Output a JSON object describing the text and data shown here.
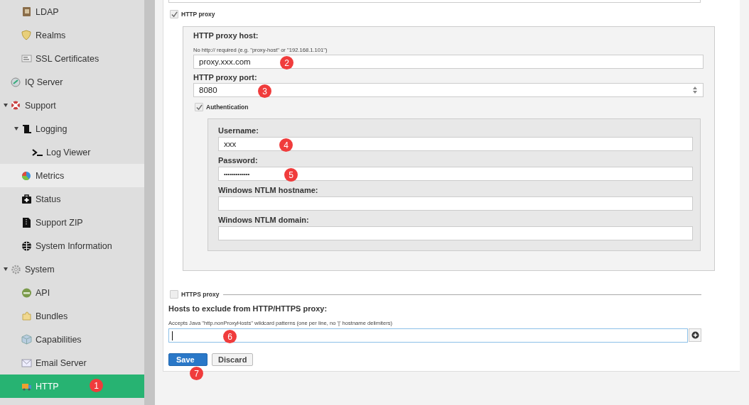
{
  "sidebar": {
    "items": [
      {
        "children": [
          {
            "label": "LDAP",
            "selected": false,
            "hovered": false
          },
          {
            "label": "Realms",
            "selected": false,
            "hovered": false
          },
          {
            "label": "SSL Certificates",
            "selected": false,
            "hovered": false
          }
        ]
      },
      {
        "label": "IQ Server",
        "selected": false,
        "hovered": false
      },
      {
        "label": "Support",
        "selected": false,
        "hovered": false,
        "expanded": true,
        "children": [
          {
            "label": "Logging",
            "selected": false,
            "hovered": false,
            "expanded": true,
            "children": [
              {
                "label": "Log Viewer",
                "selected": false,
                "hovered": false
              }
            ]
          },
          {
            "label": "Metrics",
            "selected": false,
            "hovered": true
          },
          {
            "label": "Status",
            "selected": false,
            "hovered": false
          },
          {
            "label": "Support ZIP",
            "selected": false,
            "hovered": false
          },
          {
            "label": "System Information",
            "selected": false,
            "hovered": false
          }
        ]
      },
      {
        "label": "System",
        "selected": false,
        "hovered": false,
        "expanded": true,
        "children": [
          {
            "label": "API",
            "selected": false,
            "hovered": false
          },
          {
            "label": "Bundles",
            "selected": false,
            "hovered": false
          },
          {
            "label": "Capabilities",
            "selected": false,
            "hovered": false
          },
          {
            "label": "Email Server",
            "selected": false,
            "hovered": false
          },
          {
            "label": "HTTP",
            "selected": true,
            "hovered": false,
            "badge": "1"
          }
        ]
      }
    ]
  },
  "form": {
    "http_proxy": {
      "label": "HTTP proxy",
      "checked": true,
      "host_label": "HTTP proxy host:",
      "host_hint": "No http:// required (e.g. \"proxy-host\" or \"192.168.1.101\")",
      "host_value": "proxy.xxx.com",
      "host_badge": "2",
      "port_label": "HTTP proxy port:",
      "port_value": "8080",
      "port_badge": "3",
      "authentication": {
        "label": "Authentication",
        "checked": true,
        "fields": [
          {
            "label": "Username:",
            "value": "xxx",
            "kind": "text",
            "badge": "4"
          },
          {
            "label": "Password:",
            "value": "•••••••••••••",
            "kind": "password",
            "badge": "5"
          },
          {
            "label": "Windows NTLM hostname:",
            "kind": "text"
          },
          {
            "label": "Windows NTLM domain:",
            "kind": "text"
          }
        ]
      }
    },
    "https_proxy": {
      "label": "HTTPS proxy",
      "checked": false
    },
    "exclude": {
      "label": "Hosts to exclude from HTTP/HTTPS proxy:",
      "hint": "Accepts Java \"http.nonProxyHosts\" wildcard patterns (one per line, no '|' hostname delimiters)",
      "badge": "6"
    },
    "buttons": [
      {
        "label": "Save",
        "kind": "primary",
        "badge": "7"
      },
      {
        "label": "Discard",
        "kind": "secondary"
      }
    ]
  }
}
